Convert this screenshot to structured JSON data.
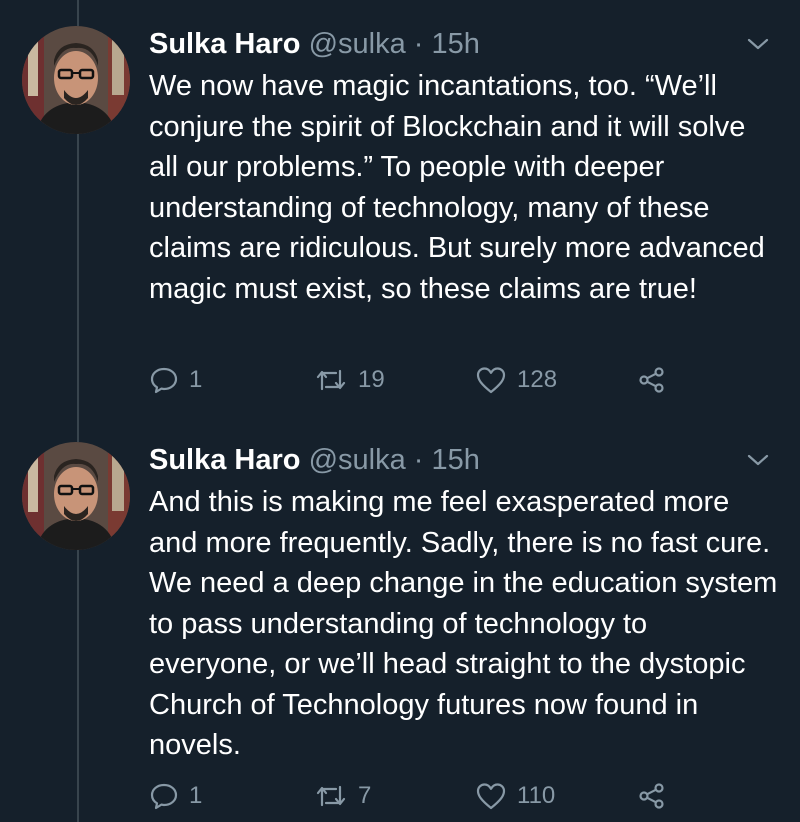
{
  "tweets": [
    {
      "author_name": "Sulka Haro",
      "author_handle": "@sulka",
      "separator": "·",
      "time": "15h",
      "text": "We now have magic incantations, too. “We’ll conjure the spirit of Blockchain and it will solve all our problems.” To people with deeper understanding of technology, many of these claims are ridiculous. But surely more advanced magic must exist, so these claims are true!",
      "replies": "1",
      "retweets": "19",
      "likes": "128"
    },
    {
      "author_name": "Sulka Haro",
      "author_handle": "@sulka",
      "separator": "·",
      "time": "15h",
      "text": "And this is making me feel exasperated more and more frequently. Sadly, there is no fast cure. We need a deep change in the education system to pass understanding of technology to everyone, or we’ll head straight to the dystopic Church of Technology futures now found in novels.",
      "replies": "1",
      "retweets": "7",
      "likes": "110"
    }
  ],
  "icons": {
    "reply": "reply-icon",
    "retweet": "retweet-icon",
    "like": "heart-icon",
    "share": "share-icon",
    "menu": "chevron-down-icon"
  },
  "colors": {
    "background": "#15202b",
    "secondary_text": "#8899a6",
    "primary_text": "#ffffff",
    "thread_line": "#38444d"
  }
}
